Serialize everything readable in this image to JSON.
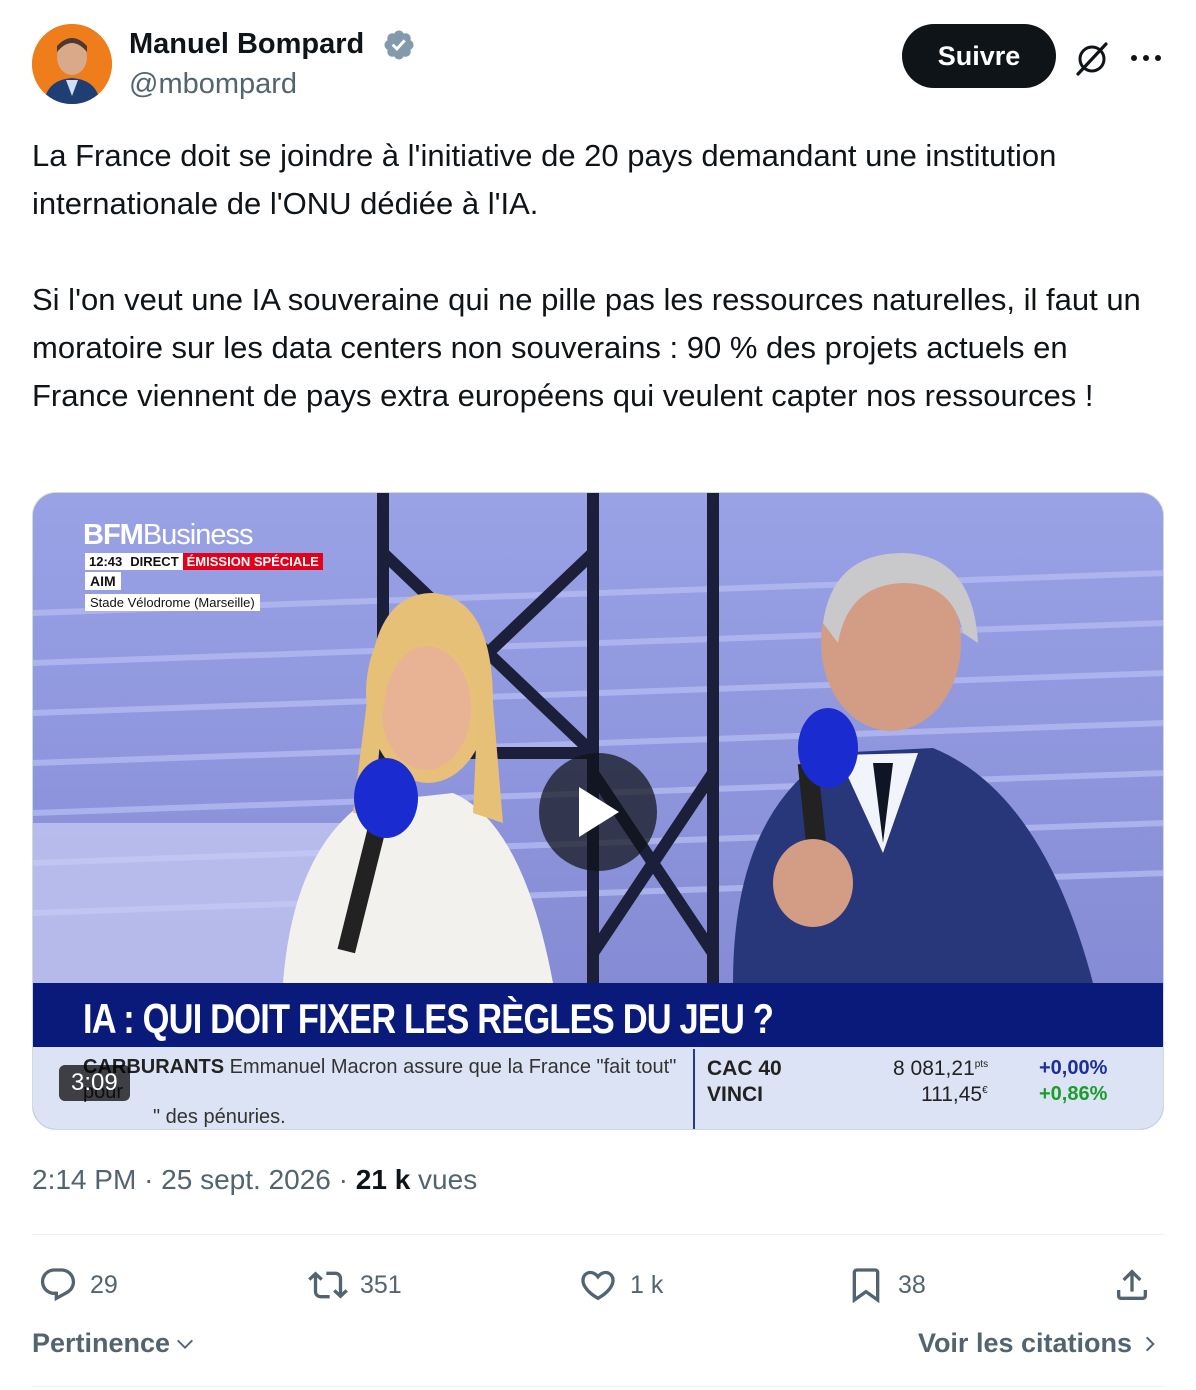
{
  "author": {
    "name": "Manuel Bompard",
    "handle": "@mbompard",
    "verified": true
  },
  "header": {
    "follow_label": "Suivre",
    "grok_icon": "grok-icon",
    "more_icon": "more-icon"
  },
  "tweet": {
    "paragraph1": "La France doit se joindre à l'initiative de 20 pays demandant une institution internationale de l'ONU dédiée à l'IA.",
    "paragraph2": "Si l'on veut une IA souveraine qui ne pille pas les ressources naturelles, il faut un moratoire sur les data centers non souverains : 90 % des projets actuels en France viennent de pays extra européens qui veulent capter nos ressources !"
  },
  "media": {
    "duration": "3:09",
    "channel_bold": "BFM",
    "channel_light": "Business",
    "live_time": "12:43",
    "live_label": "DIRECT",
    "special_label": "ÉMISSION SPÉCIALE",
    "program": "AIM",
    "venue": "Stade Vélodrome (Marseille)",
    "headline": "IA : QUI DOIT FIXER LES RÈGLES DU JEU ?",
    "ticker_topic": "CARBURANTS",
    "ticker_text": "Emmanuel Macron assure que la France \"fait tout\" pour",
    "ticker_text2": "\" des pénuries.",
    "stocks": [
      {
        "name": "CAC 40",
        "value": "8 081,21",
        "unit": "pts",
        "change": "+0,00%"
      },
      {
        "name": "VINCI",
        "value": "111,45",
        "unit": "€",
        "change": "+0,86%"
      }
    ]
  },
  "meta": {
    "time": "2:14 PM",
    "date": "25 sept. 2026",
    "views_count": "21 k",
    "views_label": "vues"
  },
  "actions": {
    "replies": "29",
    "reposts": "351",
    "likes": "1 k",
    "bookmarks": "38"
  },
  "footer": {
    "sort_label": "Pertinence",
    "quotes_label": "Voir les citations"
  },
  "colors": {
    "text_primary": "#0f1419",
    "text_secondary": "#536471",
    "verified_badge": "#829aab",
    "follow_bg": "#0f1419",
    "banner_blue": "#0a1a7a",
    "positive_green": "#1a9e2a",
    "neutral_blue": "#1d2f9a"
  }
}
